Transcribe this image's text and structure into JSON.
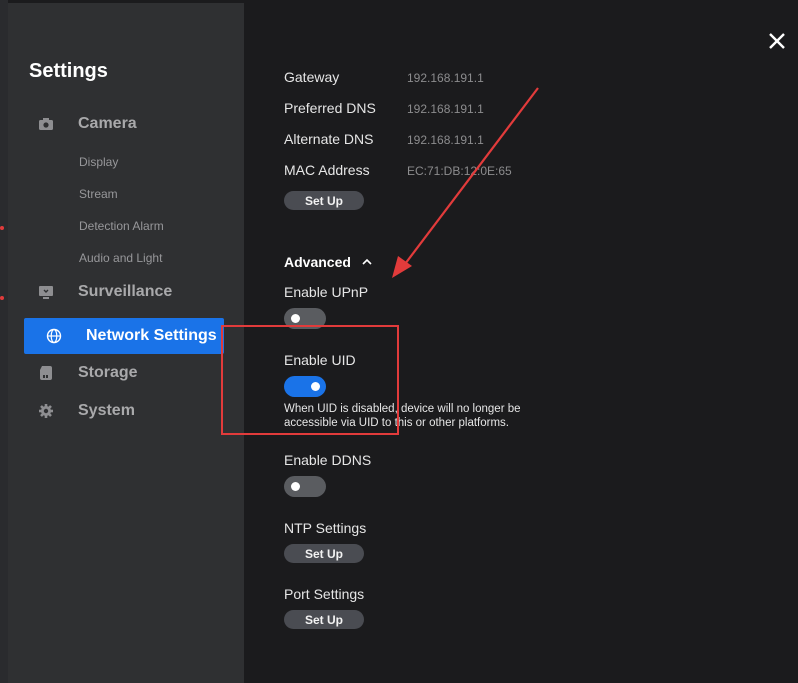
{
  "sidebar": {
    "title": "Settings",
    "items": [
      {
        "label": "Camera",
        "icon": "camera-icon"
      },
      {
        "label": "Surveillance",
        "icon": "monitor-icon"
      },
      {
        "label": "Network Settings",
        "icon": "globe-icon"
      },
      {
        "label": "Storage",
        "icon": "storage-icon"
      },
      {
        "label": "System",
        "icon": "gear-icon"
      }
    ],
    "camera_subitems": [
      "Display",
      "Stream",
      "Detection Alarm",
      "Audio and Light"
    ]
  },
  "network": {
    "rows": [
      {
        "label": "Gateway",
        "value": "192.168.191.1"
      },
      {
        "label": "Preferred DNS",
        "value": "192.168.191.1"
      },
      {
        "label": "Alternate DNS",
        "value": "192.168.191.1"
      },
      {
        "label": "MAC Address",
        "value": "EC:71:DB:12:0E:65"
      }
    ],
    "setup_label": "Set Up",
    "advanced_label": "Advanced",
    "upnp": {
      "label": "Enable UPnP",
      "enabled": false
    },
    "uid": {
      "label": "Enable UID",
      "enabled": true,
      "hint": "When UID is disabled, device will no longer be accessible via UID to this or other platforms."
    },
    "ddns": {
      "label": "Enable DDNS",
      "enabled": false
    },
    "ntp": {
      "label": "NTP Settings",
      "button": "Set Up"
    },
    "port": {
      "label": "Port Settings",
      "button": "Set Up"
    }
  },
  "colors": {
    "accent": "#1a73e8",
    "annotation": "#e23b3b"
  }
}
